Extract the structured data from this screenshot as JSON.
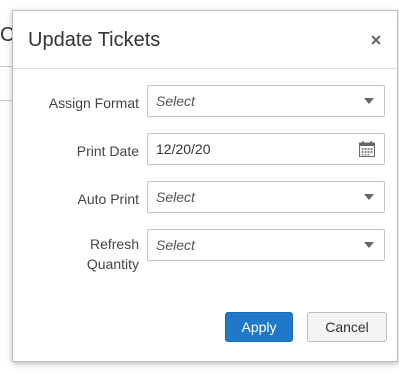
{
  "dialog": {
    "title": "Update Tickets",
    "close_icon": "close-icon"
  },
  "background": {
    "fragment_text": "C"
  },
  "form": {
    "assign_format": {
      "label": "Assign Format",
      "value": "Select",
      "icon": "chevron-down-icon"
    },
    "print_date": {
      "label": "Print Date",
      "value": "12/20/20",
      "icon": "calendar-icon"
    },
    "auto_print": {
      "label": "Auto Print",
      "value": "Select",
      "icon": "chevron-down-icon"
    },
    "refresh_quantity": {
      "label_line1": "Refresh",
      "label_line2": "Quantity",
      "value": "Select",
      "icon": "chevron-down-icon"
    }
  },
  "footer": {
    "apply_label": "Apply",
    "cancel_label": "Cancel"
  },
  "colors": {
    "primary_button": "#1f78c8",
    "secondary_button": "#f4f4f4",
    "border": "#c4c4c4"
  }
}
